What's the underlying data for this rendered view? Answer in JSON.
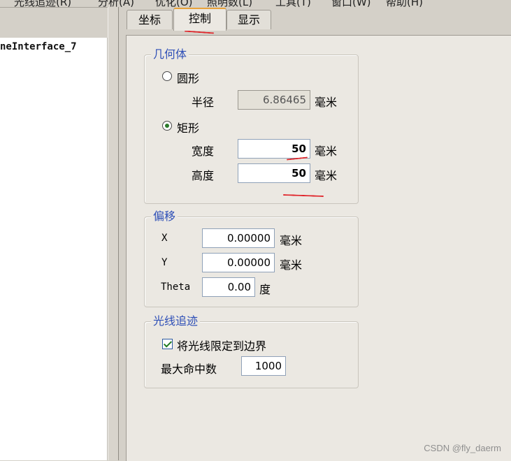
{
  "menu": {
    "items": [
      "光线追迹(R)",
      "分析(A)",
      "优化(O)",
      "照明数(L)",
      "工具(T)",
      "窗口(W)",
      "帮助(H)"
    ]
  },
  "tree": {
    "item": "neInterface_7"
  },
  "tabs": [
    {
      "label": "坐标",
      "active": false
    },
    {
      "label": "控制",
      "active": true
    },
    {
      "label": "显示",
      "active": false
    }
  ],
  "geometry": {
    "title": "几何体",
    "circle": {
      "label": "圆形",
      "selected": false
    },
    "radius": {
      "label": "半径",
      "value": "6.86465",
      "unit": "毫米"
    },
    "rectangle": {
      "label": "矩形",
      "selected": true
    },
    "width": {
      "label": "宽度",
      "value": "50",
      "unit": "毫米"
    },
    "height": {
      "label": "高度",
      "value": "50",
      "unit": "毫米"
    }
  },
  "offset": {
    "title": "偏移",
    "x": {
      "label": "X",
      "value": "0.00000",
      "unit": "毫米"
    },
    "y": {
      "label": "Y",
      "value": "0.00000",
      "unit": "毫米"
    },
    "theta": {
      "label": "Theta",
      "value": "0.00",
      "unit": "度"
    }
  },
  "raytrace": {
    "title": "光线追迹",
    "limit_checkbox": {
      "label": "将光线限定到边界",
      "checked": true
    },
    "max_hits": {
      "label": "最大命中数",
      "value": "1000"
    }
  },
  "watermark": "CSDN @fly_daerm",
  "colors": {
    "group_title": "#2e4fb7",
    "annotation_red": "#e0242a",
    "tab_highlight": "#e8a23a"
  }
}
